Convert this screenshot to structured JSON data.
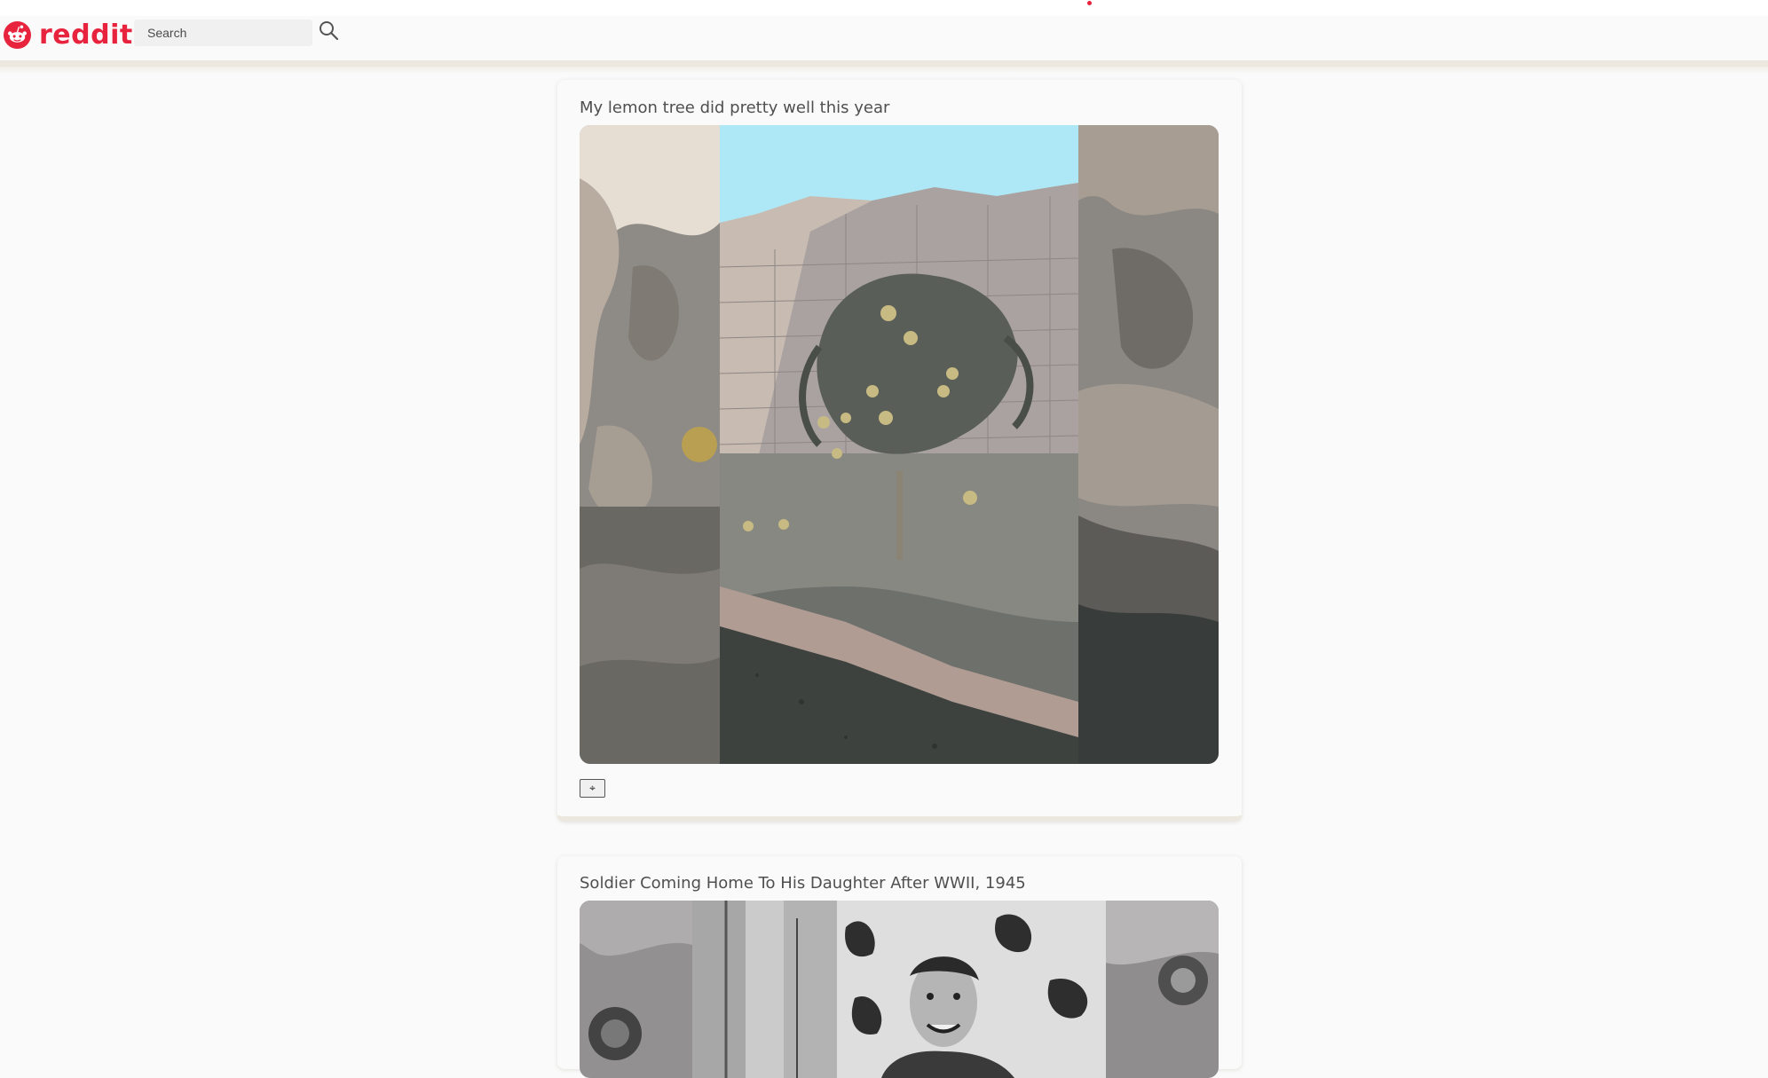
{
  "header": {
    "logo_text": "reddit",
    "brand_color": "#e8233d",
    "search": {
      "placeholder": "Search",
      "value": ""
    },
    "search_icon": "magnifier-icon"
  },
  "feed": {
    "posts": [
      {
        "title": "My lemon tree did pretty well this year",
        "media": "photo of a small lemon tree in front of a cinder block wall",
        "expand_button_glyph": "⌖",
        "expand_icon": "expand-icon"
      },
      {
        "title": "Soldier Coming Home To His Daughter After WWII, 1945",
        "media": "black and white photo of a smiling soldier"
      }
    ]
  }
}
